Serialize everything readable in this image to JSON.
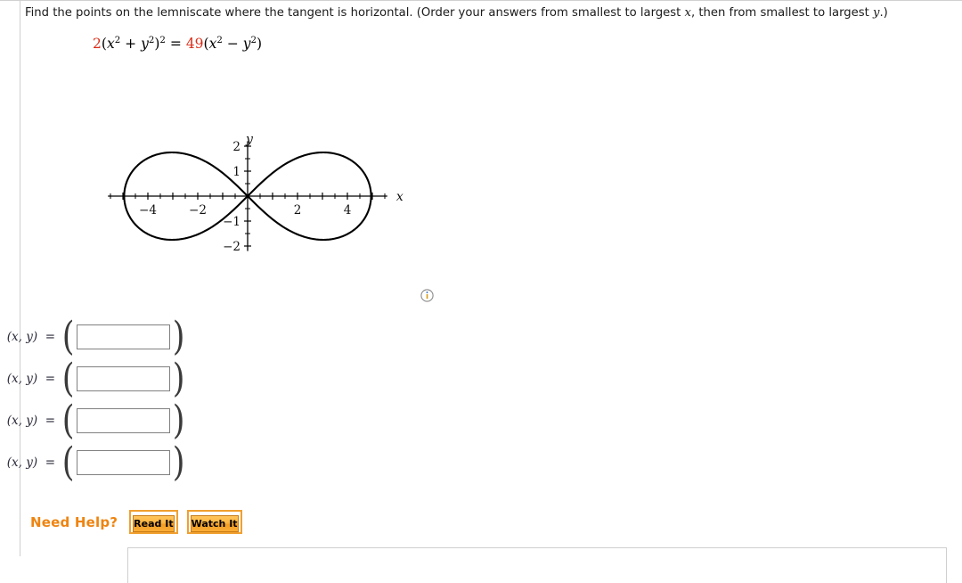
{
  "question": {
    "text_part1": "Find the points on the lemniscate where the tangent is horizontal. (Order your answers from smallest to largest ",
    "var_x": "x",
    "text_part2": ", then from smallest to largest ",
    "var_y": "y",
    "text_part3": ".)",
    "full_text": "Find the points on the lemniscate where the tangent is horizontal. (Order your answers from smallest to largest x, then from smallest to largest y.)"
  },
  "equation": {
    "coefficient_left": "2",
    "coefficient_right": "49",
    "full_text": "2(x² + y²)² = 49(x² − y²)",
    "number_color": "#d92b16",
    "left_open": "(",
    "left_var1": "x",
    "left_sup1": "2",
    "left_plus": "+",
    "left_var2": "y",
    "left_sup2": "2",
    "left_close": ")",
    "left_outer_sup": "2",
    "equals": "=",
    "right_open": "(",
    "right_var1": "x",
    "right_sup1": "2",
    "right_minus": "−",
    "right_var2": "y",
    "right_sup2": "2",
    "right_close": ")"
  },
  "chart_data": {
    "type": "line",
    "title": "",
    "xlabel": "x",
    "ylabel": "y",
    "xlim": [
      -5.6,
      5.6
    ],
    "ylim": [
      -2.2,
      2.2
    ],
    "grid": false,
    "legend": null,
    "x_tick_labels": [
      "-4",
      "-2",
      "2",
      "4"
    ],
    "x_tick_values": [
      -4,
      -2,
      2,
      4
    ],
    "x_minor_ticks": [
      -5,
      -4,
      -3,
      -2,
      -1,
      1,
      2,
      3,
      4,
      5
    ],
    "y_tick_labels": [
      "2",
      "1",
      "-1",
      "-2"
    ],
    "y_tick_values": [
      2,
      1,
      -1,
      -2
    ],
    "curve_name": "lemniscate",
    "equation": "2(x^2 + y^2)^2 = 49(x^2 - y^2)",
    "x_intercepts": [
      -4.95,
      0,
      4.95
    ],
    "max_y": 1.75,
    "min_y": -1.75,
    "max_y_at_x": 3.03,
    "axis_color": "#000000",
    "curve_color": "#000000"
  },
  "info_icon": {
    "name": "info-icon",
    "glyph": "i"
  },
  "answers": {
    "label": "(x, y)  =",
    "label_x": "x",
    "label_y": "y",
    "label_eq": "=",
    "rows": [
      {
        "value": "",
        "placeholder": ""
      },
      {
        "value": "",
        "placeholder": ""
      },
      {
        "value": "",
        "placeholder": ""
      },
      {
        "value": "",
        "placeholder": ""
      }
    ]
  },
  "help": {
    "title": "Need Help?",
    "read_it": "Read It",
    "watch_it": "Watch It",
    "accent_color": "#ee8410"
  }
}
